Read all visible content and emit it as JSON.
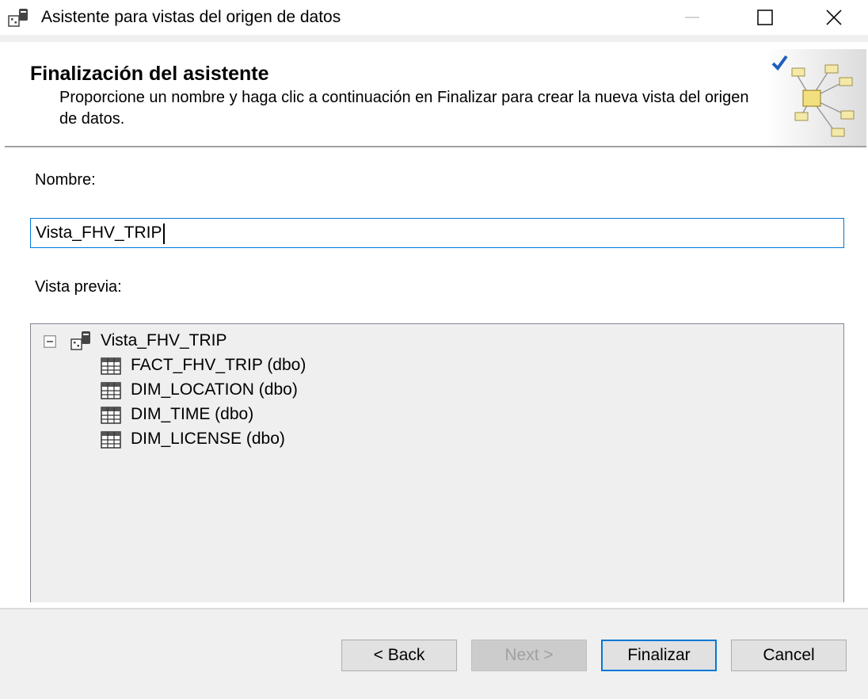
{
  "window": {
    "title": "Asistente para vistas del origen de datos",
    "controls": [
      "minimize",
      "maximize",
      "close"
    ]
  },
  "header": {
    "title": "Finalización del asistente",
    "subtitle": "Proporcione un nombre y haga clic a continuación en Finalizar para crear la nueva vista del origen de datos.",
    "art_icon": "data-source-view-wizard-icon"
  },
  "form": {
    "name_label": "Nombre:",
    "name_value": "Vista_FHV_TRIP",
    "preview_label": "Vista previa:"
  },
  "tree": {
    "root": {
      "label": "Vista_FHV_TRIP",
      "expanded": true,
      "icon": "data-source-view-icon"
    },
    "items": [
      {
        "label": "FACT_FHV_TRIP (dbo)",
        "icon": "table-icon"
      },
      {
        "label": "DIM_LOCATION (dbo)",
        "icon": "table-icon"
      },
      {
        "label": "DIM_TIME (dbo)",
        "icon": "table-icon"
      },
      {
        "label": "DIM_LICENSE (dbo)",
        "icon": "table-icon"
      }
    ]
  },
  "buttons": {
    "back": "< Back",
    "next": "Next >",
    "finish": "Finalizar",
    "cancel": "Cancel"
  },
  "colors": {
    "accent": "#0078d7",
    "footer_bg": "#f0f0f0",
    "tree_bg": "#efefef"
  }
}
